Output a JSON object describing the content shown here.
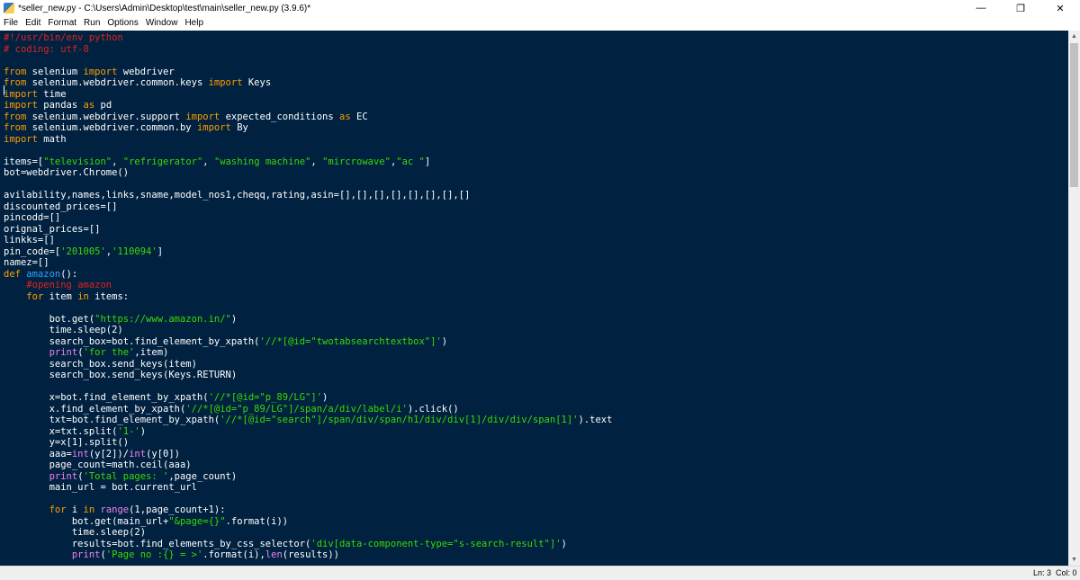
{
  "window": {
    "title": "*seller_new.py - C:\\Users\\Admin\\Desktop\\test\\main\\seller_new.py (3.9.6)*",
    "minimize_glyph": "—",
    "maximize_glyph": "❐",
    "close_glyph": "✕"
  },
  "menu": [
    "File",
    "Edit",
    "Format",
    "Run",
    "Options",
    "Window",
    "Help"
  ],
  "editor": {
    "language": "python",
    "colors": {
      "background": "#002240",
      "default": "#ffffff",
      "keyword": "#ff9d00",
      "string": "#3ad900",
      "comment": "#e02020",
      "builtin": "#ee82ee",
      "definition": "#2ea0ff"
    },
    "lines": [
      "#!/usr/bin/env python",
      "# coding: utf-8",
      "",
      "from selenium import webdriver",
      "from selenium.webdriver.common.keys import Keys",
      "import time",
      "import pandas as pd",
      "from selenium.webdriver.support import expected_conditions as EC",
      "from selenium.webdriver.common.by import By",
      "import math",
      "",
      "items=[\"television\", \"refrigerator\", \"washing machine\", \"mircrowave\",\"ac \"]",
      "bot=webdriver.Chrome()",
      "",
      "avilability,names,links,sname,model_nos1,cheqq,rating,asin=[],[],[],[],[],[],[],[]",
      "discounted_prices=[]",
      "pincodd=[]",
      "orignal_prices=[]",
      "linkks=[]",
      "pin_code=['201005','110094']",
      "namez=[]",
      "def amazon():",
      "    #opening amazon",
      "    for item in items:",
      "",
      "        bot.get(\"https://www.amazon.in/\")",
      "        time.sleep(2)",
      "        search_box=bot.find_element_by_xpath('//*[@id=\"twotabsearchtextbox\"]')",
      "        print('for the',item)",
      "        search_box.send_keys(item)",
      "        search_box.send_keys(Keys.RETURN)",
      "",
      "        x=bot.find_element_by_xpath('//*[@id=\"p_89/LG\"]')",
      "        x.find_element_by_xpath('//*[@id=\"p_89/LG\"]/span/a/div/label/i').click()",
      "        txt=bot.find_element_by_xpath('//*[@id=\"search\"]/span/div/span/h1/div/div[1]/div/div/span[1]').text",
      "        x=txt.split('1-')",
      "        y=x[1].split()",
      "        aaa=int(y[2])/int(y[0])",
      "        page_count=math.ceil(aaa)",
      "        print('Total pages: ',page_count)",
      "        main_url = bot.current_url",
      "",
      "        for i in range(1,page_count+1):",
      "            bot.get(main_url+\"&page={}\".format(i))",
      "            time.sleep(2)",
      "            results=bot.find_elements_by_css_selector('div[data-component-type=\"s-search-result\"]')",
      "            print('Page no :{} = >'.format(i),len(results))"
    ]
  },
  "status": {
    "line": "Ln: 3",
    "column": "Col: 0"
  }
}
